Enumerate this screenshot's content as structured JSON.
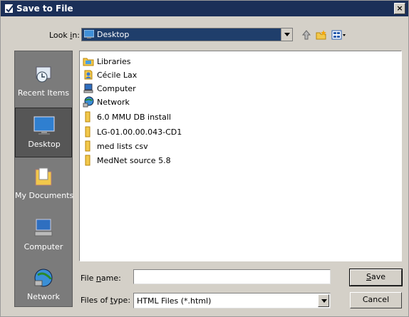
{
  "window": {
    "title": "Save to File",
    "close_glyph": "×"
  },
  "toolbar": {
    "lookin_label_pre": "Look ",
    "lookin_label_key": "i",
    "lookin_label_post": "n:",
    "lookin_value": "Desktop",
    "icons": [
      "up-folder-icon",
      "new-folder-icon",
      "view-menu-icon"
    ]
  },
  "places": [
    {
      "label": "Recent Items",
      "icon": "recent-items-icon",
      "selected": false
    },
    {
      "label": "Desktop",
      "icon": "desktop-icon",
      "selected": true
    },
    {
      "label": "My Documents",
      "icon": "my-documents-icon",
      "selected": false
    },
    {
      "label": "Computer",
      "icon": "computer-icon",
      "selected": false
    },
    {
      "label": "Network",
      "icon": "network-icon",
      "selected": false
    }
  ],
  "files": [
    {
      "name": "Libraries",
      "icon": "libraries-icon"
    },
    {
      "name": "Cécile Lax",
      "icon": "user-icon"
    },
    {
      "name": "Computer",
      "icon": "computer-icon"
    },
    {
      "name": "Network",
      "icon": "network-icon"
    },
    {
      "name": "6.0 MMU DB install",
      "icon": "folder-icon"
    },
    {
      "name": "LG-01.00.00.043-CD1",
      "icon": "folder-icon"
    },
    {
      "name": "med lists csv",
      "icon": "folder-icon"
    },
    {
      "name": "MedNet source 5.8",
      "icon": "folder-icon"
    }
  ],
  "form": {
    "filename_label_pre": "File ",
    "filename_label_key": "n",
    "filename_label_post": "ame:",
    "filename_value": "",
    "filetype_label_pre": "Files of ",
    "filetype_label_key": "t",
    "filetype_label_post": "ype:",
    "filetype_value": "HTML Files (*.html)"
  },
  "buttons": {
    "save_key": "S",
    "save_rest": "ave",
    "cancel": "Cancel"
  },
  "colors": {
    "titlebar": "#1b2f58",
    "places_bg": "#7b7b7b",
    "combo_highlight": "#1f3e6b",
    "dialog_bg": "#d4d0c8"
  }
}
